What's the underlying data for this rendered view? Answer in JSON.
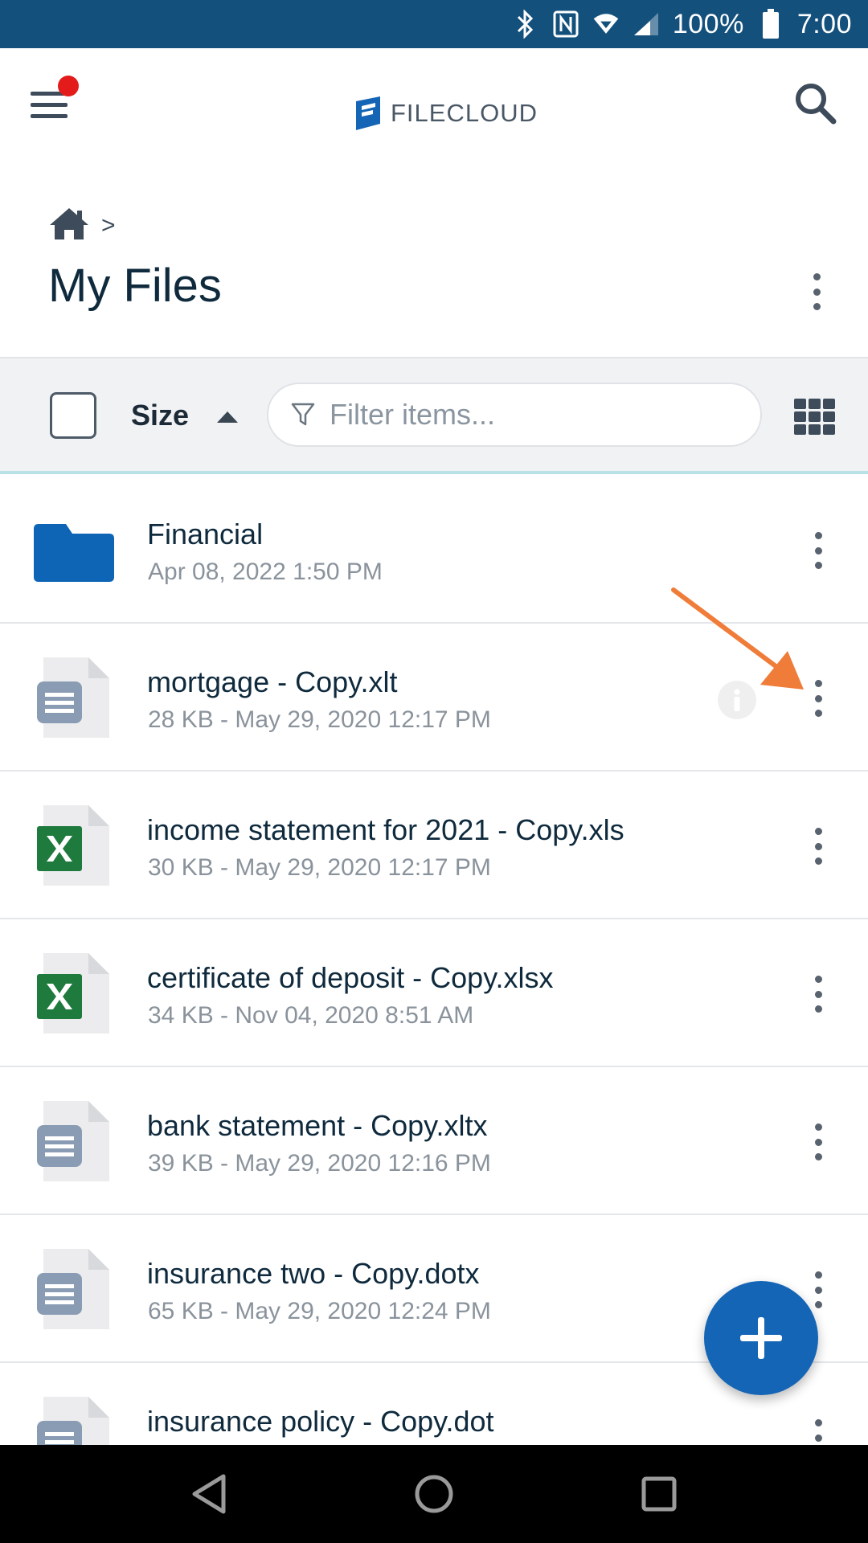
{
  "status_bar": {
    "battery": "100%",
    "time": "7:00"
  },
  "app_bar": {
    "logo_text": "FILECLOUD"
  },
  "breadcrumb": {
    "separator": ">"
  },
  "page": {
    "title": "My Files"
  },
  "toolbar": {
    "sort_label": "Size",
    "filter_placeholder": "Filter items..."
  },
  "files": [
    {
      "type": "folder",
      "name": "Financial",
      "meta": "Apr 08, 2022 1:50 PM"
    },
    {
      "type": "doc",
      "name": "mortgage - Copy.xlt",
      "meta": "28 KB - May 29, 2020 12:17 PM"
    },
    {
      "type": "excel",
      "name": "income statement for 2021 - Copy.xls",
      "meta": "30 KB - May 29, 2020 12:17 PM"
    },
    {
      "type": "excel",
      "name": "certificate of deposit - Copy.xlsx",
      "meta": "34 KB - Nov 04, 2020 8:51 AM"
    },
    {
      "type": "doc",
      "name": "bank statement - Copy.xltx",
      "meta": "39 KB - May 29, 2020 12:16 PM"
    },
    {
      "type": "doc",
      "name": "insurance two - Copy.dotx",
      "meta": "65 KB - May 29, 2020 12:24 PM"
    },
    {
      "type": "doc",
      "name": "insurance policy - Copy.dot",
      "meta": ""
    }
  ],
  "colors": {
    "status_bar": "#14507c",
    "accent": "#1565b6",
    "folder": "#0f65b5",
    "excel": "#1f7a3e",
    "annotation_arrow": "#f07c3a",
    "notification_dot": "#e31b1b"
  }
}
